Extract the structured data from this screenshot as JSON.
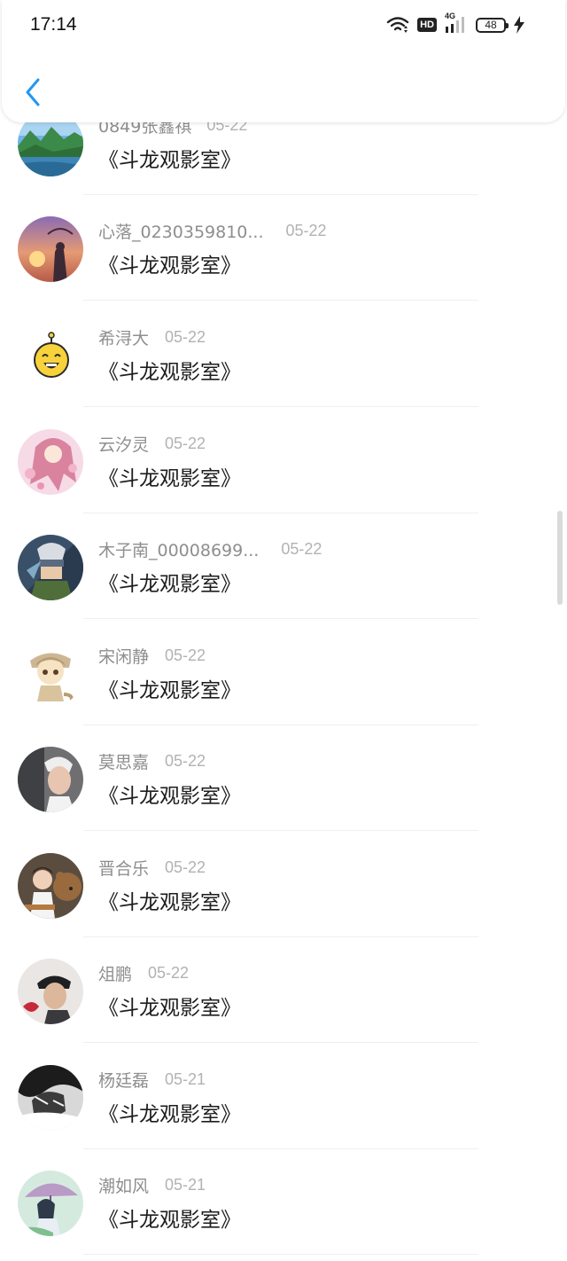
{
  "status_bar": {
    "time": "17:14",
    "hd_label": "HD",
    "network_label": "4G",
    "battery": "48"
  },
  "header": {
    "back_icon": "chevron-left-icon",
    "accent_color": "#2196f3"
  },
  "items": [
    {
      "name": "0849张鑫祺",
      "date": "05-22",
      "title": "《斗龙观影室》",
      "avatar": "landscape"
    },
    {
      "name": "心落_0230359810...",
      "date": "05-22",
      "title": "《斗龙观影室》",
      "avatar": "sunset"
    },
    {
      "name": "希浔大",
      "date": "05-22",
      "title": "《斗龙观影室》",
      "avatar": "emoji"
    },
    {
      "name": "云汐灵",
      "date": "05-22",
      "title": "《斗龙观影室》",
      "avatar": "anime-pink"
    },
    {
      "name": "木子南_00008699...",
      "date": "05-22",
      "title": "《斗龙观影室》",
      "avatar": "ninja"
    },
    {
      "name": "宋闲静",
      "date": "05-22",
      "title": "《斗龙观影室》",
      "avatar": "chibi"
    },
    {
      "name": "莫思嘉",
      "date": "05-22",
      "title": "《斗龙观影室》",
      "avatar": "portrait-boy"
    },
    {
      "name": "晋合乐",
      "date": "05-22",
      "title": "《斗龙观影室》",
      "avatar": "girl-bear"
    },
    {
      "name": "俎鹏",
      "date": "05-22",
      "title": "《斗龙观影室》",
      "avatar": "hat-man"
    },
    {
      "name": "杨廷磊",
      "date": "05-21",
      "title": "《斗龙观影室》",
      "avatar": "bw-figure"
    },
    {
      "name": "潮如风",
      "date": "05-21",
      "title": "《斗龙观影室》",
      "avatar": "anime-umbrella"
    }
  ]
}
